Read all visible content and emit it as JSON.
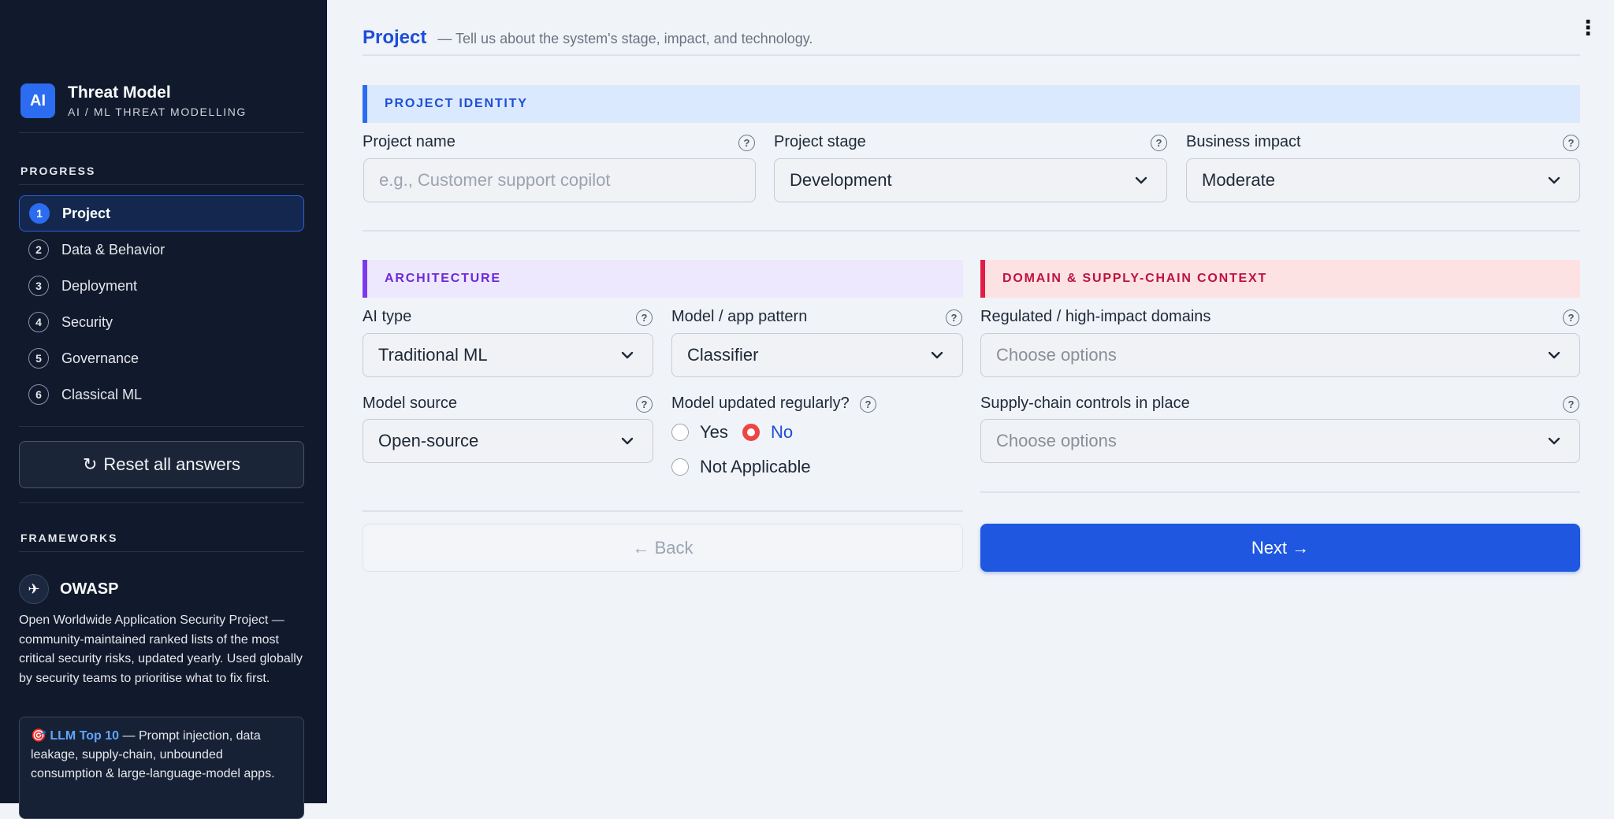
{
  "sidebar": {
    "brand_logo": "AI",
    "brand_title": "Threat Model",
    "brand_subtitle": "AI / ML THREAT MODELLING",
    "progress_heading": "PROGRESS",
    "steps": [
      {
        "num": "1",
        "label": "Project",
        "active": true
      },
      {
        "num": "2",
        "label": "Data & Behavior",
        "active": false
      },
      {
        "num": "3",
        "label": "Deployment",
        "active": false
      },
      {
        "num": "4",
        "label": "Security",
        "active": false
      },
      {
        "num": "5",
        "label": "Governance",
        "active": false
      },
      {
        "num": "6",
        "label": "Classical ML",
        "active": false
      }
    ],
    "reset_label": "Reset all answers",
    "reset_icon": "rotate-ccw-icon",
    "frameworks_heading": "FRAMEWORKS",
    "framework": {
      "icon": "plane-icon",
      "name": "OWASP",
      "description": "Open Worldwide Application Security Project — community-maintained ranked lists of the most critical security risks, updated yearly. Used globally by security teams to prioritise what to fix first.",
      "card_emoji": "🎯",
      "card_title": "LLM Top 10",
      "card_text": " — Prompt injection, data leakage, supply-chain, unbounded consumption & large-language-model apps."
    }
  },
  "page": {
    "title": "Project",
    "subtitle": "— Tell us about the system's stage, impact, and technology.",
    "menu_icon": "more-vertical-icon"
  },
  "sections": {
    "identity": {
      "heading": "PROJECT IDENTITY",
      "project_name_label": "Project name",
      "project_name_placeholder": "e.g., Customer support copilot",
      "project_name_value": "",
      "stage_label": "Project stage",
      "stage_value": "Development",
      "impact_label": "Business impact",
      "impact_value": "Moderate"
    },
    "architecture": {
      "heading": "ARCHITECTURE",
      "ai_type_label": "AI type",
      "ai_type_value": "Traditional ML",
      "pattern_label": "Model / app pattern",
      "pattern_value": "Classifier",
      "source_label": "Model source",
      "source_value": "Open-source",
      "updated_label": "Model updated regularly?",
      "updated_options": [
        "Yes",
        "No",
        "Not Applicable"
      ],
      "updated_selected": "No"
    },
    "domain": {
      "heading": "DOMAIN & SUPPLY-CHAIN CONTEXT",
      "regulated_label": "Regulated / high-impact domains",
      "regulated_placeholder": "Choose options",
      "supply_label": "Supply-chain controls in place",
      "supply_placeholder": "Choose options"
    }
  },
  "nav": {
    "back_label": "← Back",
    "next_label": "Next →"
  },
  "colors": {
    "accent": "#1f57e0",
    "sidebar_bg": "#111a2d",
    "identity_accent": "#2c6cf0",
    "architecture_accent": "#7c3aed",
    "domain_accent": "#e11d48",
    "radio_selected": "#ef4444"
  }
}
